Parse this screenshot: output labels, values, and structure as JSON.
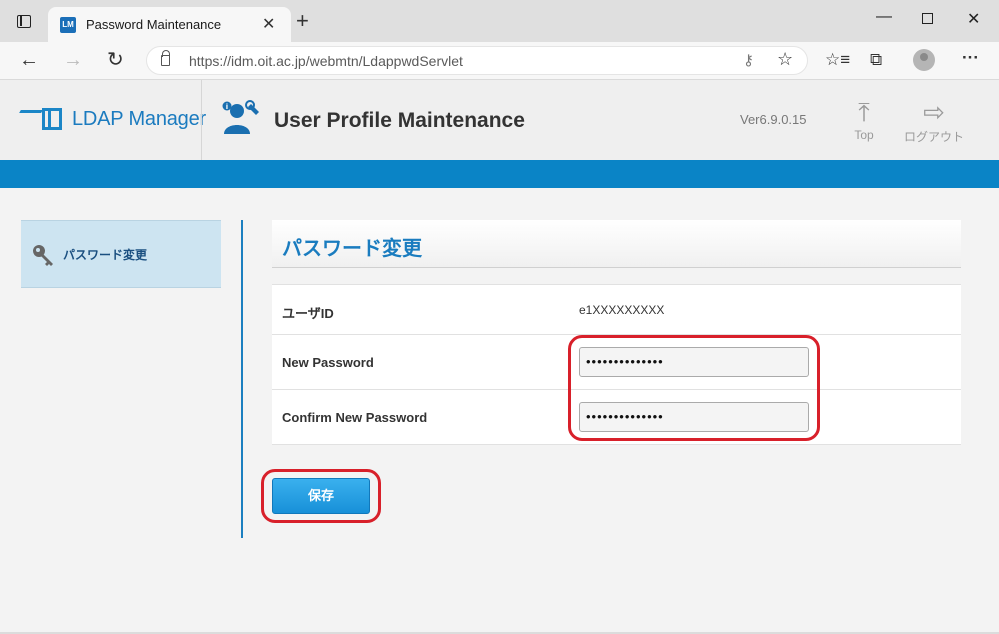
{
  "browser": {
    "tab_title": "Password Maintenance",
    "tab_favicon_text": "LM",
    "url": "https://idm.oit.ac.jp/webmtn/LdappwdServlet"
  },
  "header": {
    "logo_text": "LDAP Manager",
    "app_title": "User Profile Maintenance",
    "version": "Ver6.9.0.15",
    "top_label": "Top",
    "logout_label": "ログアウト"
  },
  "sidebar": {
    "items": [
      {
        "label": "パスワード変更",
        "icon": "key-icon"
      }
    ]
  },
  "main": {
    "section_title": "パスワード変更",
    "rows": [
      {
        "label": "ユーザID",
        "value": "e1XXXXXXXXX"
      },
      {
        "label": "New Password",
        "value": "••••••••••••••"
      },
      {
        "label": "Confirm New Password",
        "value": "••••••••••••••"
      }
    ],
    "save_label": "保存"
  },
  "colors": {
    "accent": "#0a84c6",
    "highlight": "#d8202a",
    "title_blue": "#1a7cbf"
  }
}
